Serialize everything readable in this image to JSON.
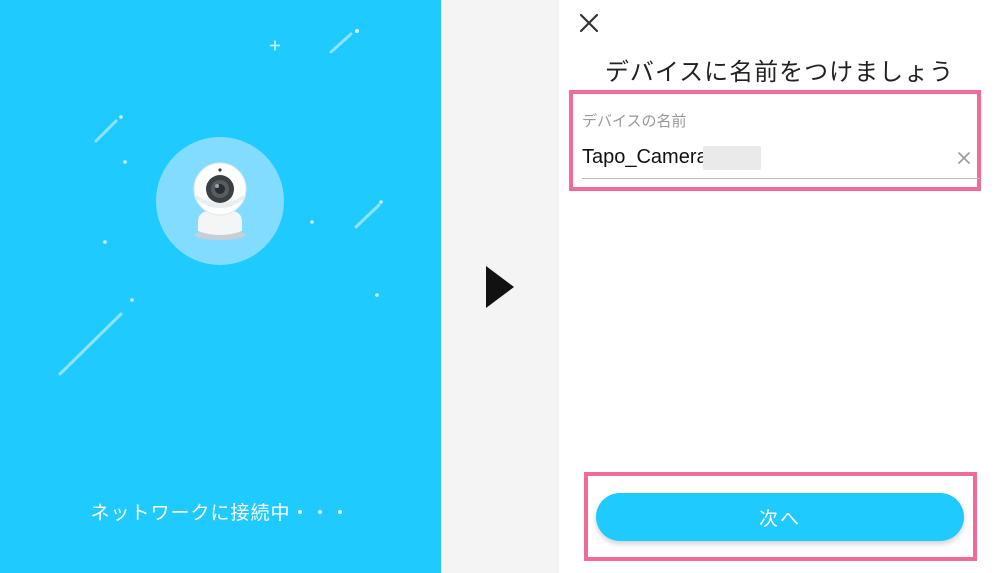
{
  "left_panel": {
    "status_text": "ネットワークに接続中・・・",
    "background_color": "#1ecaff",
    "camera_icon": "ip-camera-icon"
  },
  "arrow": {
    "icon": "play-arrow-icon"
  },
  "right_panel": {
    "close_icon": "close-icon",
    "title": "デバイスに名前をつけましょう",
    "name_field": {
      "label": "デバイスの名前",
      "value": "Tapo_Camera",
      "clear_icon": "clear-icon"
    },
    "next_button": {
      "label": "次へ",
      "color": "#1ecaff"
    },
    "highlight_color": "#f06a9a"
  }
}
